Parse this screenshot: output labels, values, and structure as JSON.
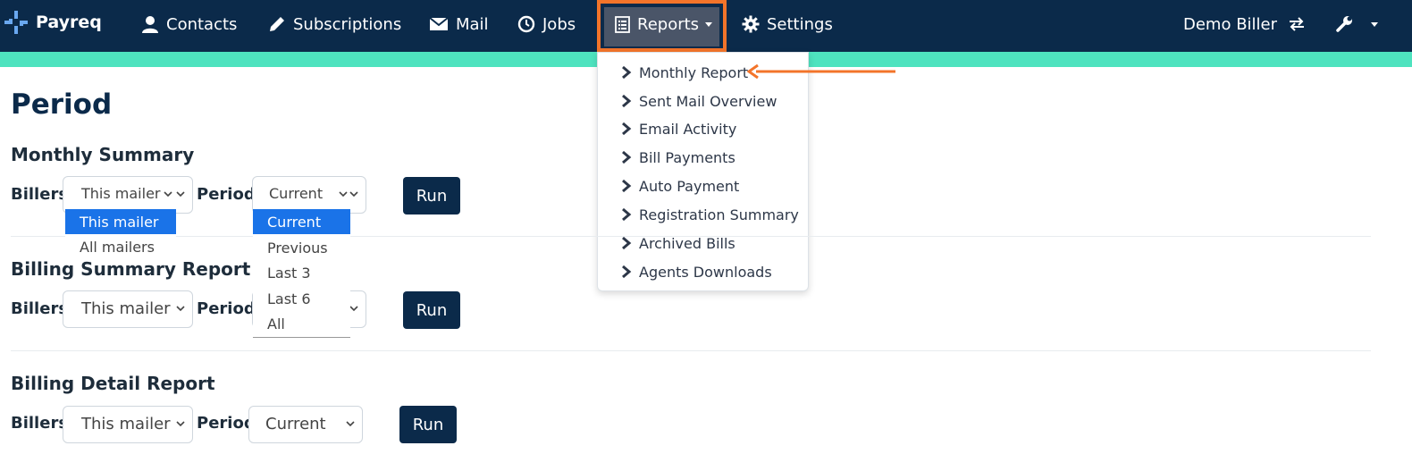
{
  "nav": {
    "brand": "Payreq",
    "contacts": "Contacts",
    "subscriptions": "Subscriptions",
    "mail": "Mail",
    "jobs": "Jobs",
    "reports": "Reports",
    "settings": "Settings",
    "account": "Demo Biller"
  },
  "reports_menu": [
    "Monthly Report",
    "Sent Mail Overview",
    "Email Activity",
    "Bill Payments",
    "Auto Payment",
    "Registration Summary",
    "Archived Bills",
    "Agents Downloads"
  ],
  "page": {
    "title": "Period"
  },
  "sections": [
    {
      "title": "Monthly Summary",
      "billers_label": "Billers",
      "billers_value": "This mailer",
      "period_label": "Period",
      "period_value": "Current",
      "run_label": "Run"
    },
    {
      "title": "Billing Summary Report",
      "billers_label": "Billers",
      "billers_value": "This mailer",
      "period_label": "Period",
      "period_value": "",
      "run_label": "Run"
    },
    {
      "title": "Billing Detail Report",
      "billers_label": "Billers",
      "billers_value": "This mailer",
      "period_label": "Period",
      "period_value": "Current",
      "run_label": "Run"
    }
  ],
  "billers_options": [
    "This mailer",
    "All mailers"
  ],
  "period_options": [
    "Current",
    "Previous",
    "Last 3",
    "Last 6",
    "All"
  ],
  "colors": {
    "navbar": "#0b2a4a",
    "teal": "#4ee3bf",
    "highlight": "#f3742a",
    "selected_option": "#1a73e8"
  }
}
